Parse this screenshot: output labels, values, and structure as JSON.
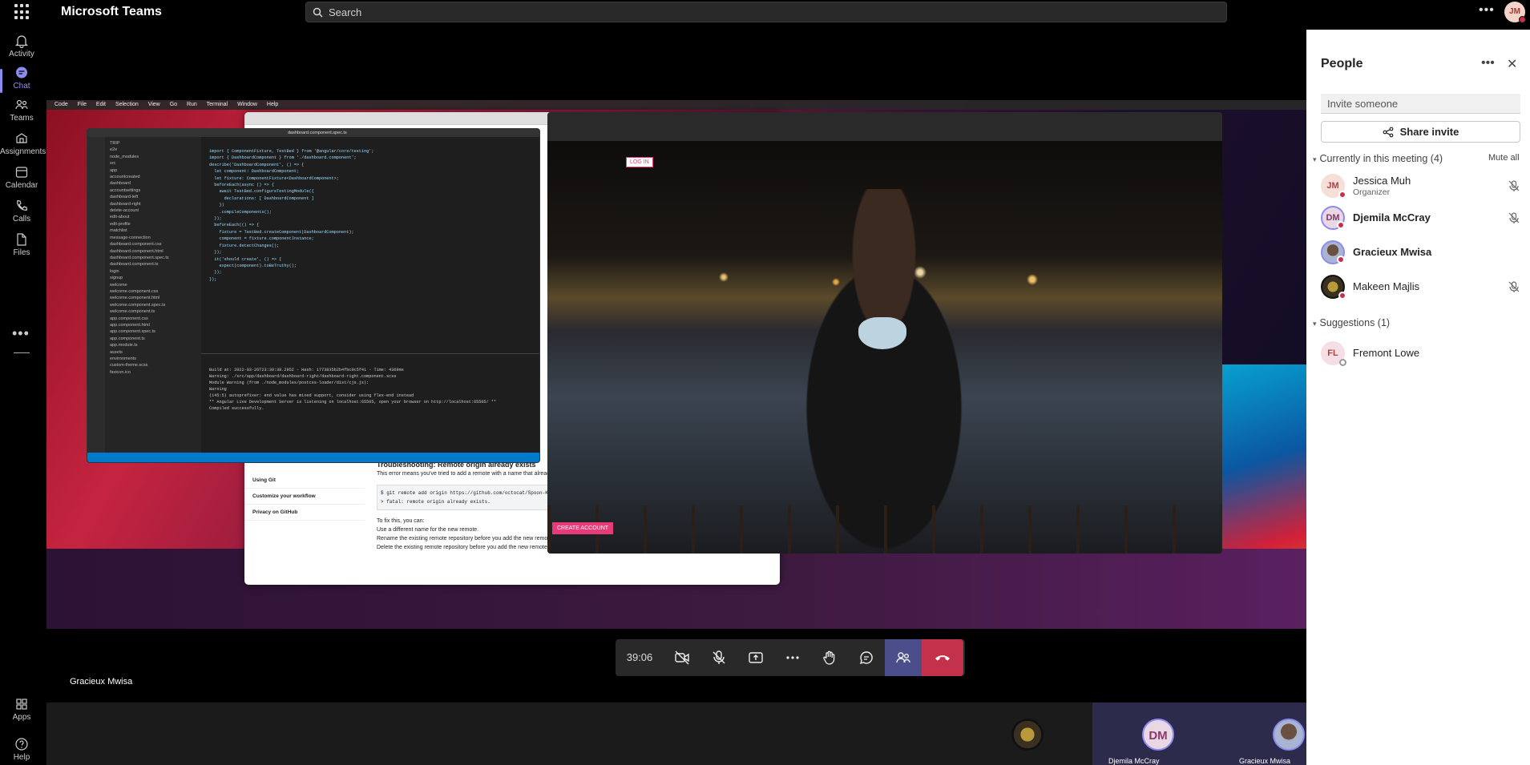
{
  "app": {
    "title": "Microsoft Teams",
    "avatar_initials": "JM"
  },
  "search": {
    "placeholder": "Search"
  },
  "rail": {
    "items": [
      {
        "label": "Activity"
      },
      {
        "label": "Chat"
      },
      {
        "label": "Teams"
      },
      {
        "label": "Assignments"
      },
      {
        "label": "Calendar"
      },
      {
        "label": "Calls"
      },
      {
        "label": "Files"
      }
    ],
    "bottom": [
      {
        "label": "Apps"
      },
      {
        "label": "Help"
      }
    ]
  },
  "stage": {
    "speaker_name": "Gracieux Mwisa",
    "shared": {
      "mac_menu": [
        "Code",
        "File",
        "Edit",
        "Selection",
        "View",
        "Go",
        "Run",
        "Terminal",
        "Window",
        "Help"
      ],
      "docs_nav": [
        "Using Git",
        "Customize your workflow",
        "Privacy on GitHub"
      ],
      "docs_heading": "Troubleshooting: Remote origin already exists",
      "docs_lines": [
        "This error means you've tried to add a remote with a name that already exists in your local repository.",
        "$ git remote add origin https://github.com/octocat/Spoon-Knife.git",
        "> fatal: remote origin already exists.",
        "To fix this, you can:",
        "Use a different name for the new remote.",
        "Rename the existing remote repository before you add the new remote. For more information, see \"Renaming a remote repository\" below.",
        "Delete the existing remote repository before you add the new remote. For more information,"
      ],
      "vscode_tab": "dashboard.component.spec.ts",
      "vscode_tree": [
        "TRIP",
        "e2e",
        "node_modules",
        "src",
        "app",
        "accountcreated",
        "dashboard",
        "accountsettings",
        "dashboard-left",
        "dashboard-right",
        "delete-account",
        "edit-about",
        "edit-profile",
        "matchlist",
        "message-connection",
        "dashboard.component.css",
        "dashboard.component.html",
        "dashboard.component.spec.ts",
        "dashboard.component.ts",
        "login",
        "signup",
        "welcome",
        "welcome.component.css",
        "welcome.component.html",
        "welcome.component.spec.ts",
        "welcome.component.ts",
        "app.component.css",
        "app.component.html",
        "app.component.spec.ts",
        "app.component.ts",
        "app.module.ts",
        "assets",
        "environments",
        "custom-theme.scss",
        "favicon.ico"
      ],
      "vscode_code": [
        "import { ComponentFixture, TestBed } from '@angular/core/testing';",
        "",
        "import { DashboardComponent } from './dashboard.component';",
        "",
        "describe('DashboardComponent', () => {",
        "  let component: DashboardComponent;",
        "  let fixture: ComponentFixture<DashboardComponent>;",
        "",
        "  beforeEach(async () => {",
        "    await TestBed.configureTestingModule({",
        "      declarations: [ DashboardComponent ]",
        "    })",
        "    .compileComponents();",
        "  });",
        "",
        "  beforeEach(() => {",
        "    fixture = TestBed.createComponent(DashboardComponent);",
        "    component = fixture.componentInstance;",
        "    fixture.detectChanges();",
        "  });",
        "",
        "  it('should create', () => {",
        "    expect(component).toBeTruthy();",
        "  });",
        "});"
      ],
      "terminal_lines": [
        "Build at: 2022-03-26T23:39:38.295Z - Hash: 1773835b2b4fbc0c5f41 - Time: 4369ms",
        "Warning: ./src/app/dashboard/dashboard-right/dashboard-right.component.scss",
        "Module Warning (from ./node_modules/postcss-loader/dist/cjs.js):",
        "Warning",
        "(145:5) autoprefixer: end value has mixed support, consider using flex-end instead",
        "** Angular Live Development Server is listening on localhost:65505, open your browser on http://localhost:65505/ **",
        "Compiled successfully."
      ],
      "site_login": "LOG IN",
      "site_create": "CREATE ACCOUNT"
    }
  },
  "controls": {
    "timer": "39:06",
    "buttons": [
      "camera-off",
      "mic-off",
      "share",
      "more",
      "raise-hand",
      "chat",
      "people",
      "leave"
    ]
  },
  "thumbnails": [
    {
      "name": ""
    },
    {
      "name": "Djemila McCray",
      "initials": "DM"
    },
    {
      "name": "Gracieux Mwisa"
    }
  ],
  "people_panel": {
    "title": "People",
    "invite_placeholder": "Invite someone",
    "share_invite": "Share invite",
    "section_current": "Currently in this meeting (4)",
    "mute_all": "Mute all",
    "participants": [
      {
        "name": "Jessica Muh",
        "role": "Organizer",
        "initials": "JM",
        "bold": false
      },
      {
        "name": "Djemila McCray",
        "role": "",
        "initials": "DM",
        "bold": true
      },
      {
        "name": "Gracieux Mwisa",
        "role": "",
        "initials": "",
        "bold": true
      },
      {
        "name": "Makeen Majlis",
        "role": "",
        "initials": "",
        "bold": false
      }
    ],
    "section_suggestions": "Suggestions (1)",
    "suggestions": [
      {
        "name": "Fremont Lowe",
        "initials": "FL"
      }
    ]
  },
  "colors": {
    "accent": "#8b8cf0",
    "leave": "#c4314b",
    "people_active": "#4c4e8c",
    "panel_bg": "#ffffff"
  }
}
